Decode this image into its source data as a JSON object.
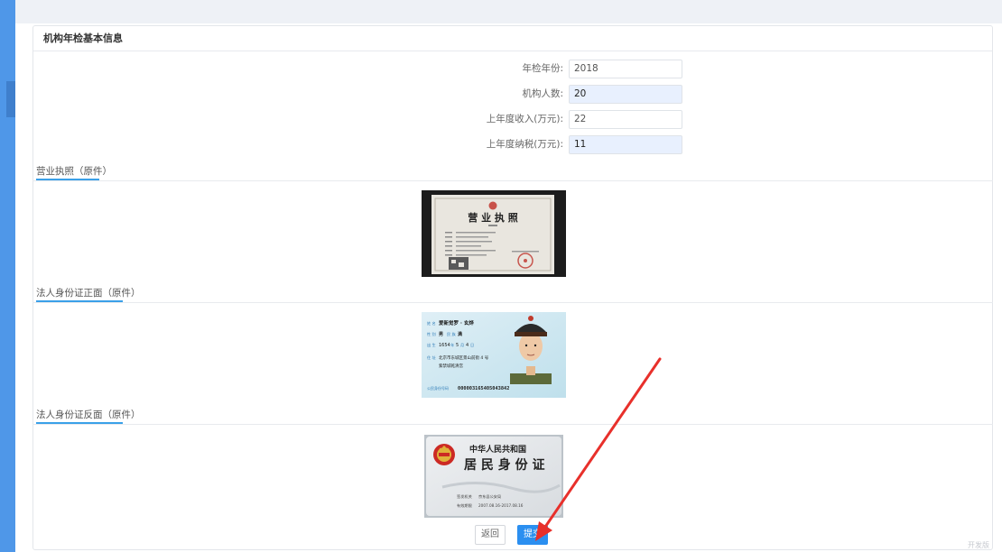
{
  "card": {
    "title": "机构年检基本信息"
  },
  "form": {
    "fields": [
      {
        "label": "年检年份:",
        "value": "2018",
        "filled": false
      },
      {
        "label": "机构人数:",
        "value": "20",
        "filled": true
      },
      {
        "label": "上年度收入(万元):",
        "value": "22",
        "filled": false
      },
      {
        "label": "上年度纳税(万元):",
        "value": "11",
        "filled": true
      }
    ]
  },
  "sections": {
    "business_license": {
      "title": "营业执照（原件）",
      "image_text": "营 业 执 照"
    },
    "id_front": {
      "title": "法人身份证正面（原件）",
      "name_label": "姓 名",
      "name": "爱新觉罗 · 玄烨",
      "gender_label": "性 别",
      "gender": "男",
      "ethnicity_label": "民 族",
      "ethnicity": "满",
      "birth_label": "出 生",
      "birth_year": "1654",
      "birth_year_unit": "年",
      "birth_month": "5",
      "birth_month_unit": "月",
      "birth_day": "4",
      "birth_day_unit": "日",
      "address_label": "住 址",
      "address_line1": "北京市东城区景山前街 4 号",
      "address_line2": "紫禁城乾清宫",
      "id_label": "公民身份号码",
      "id_number": "000003165405043842"
    },
    "id_back": {
      "title": "法人身份证反面（原件）",
      "country": "中华人民共和国",
      "card_name": "居 民 身 份 证",
      "authority_label": "签发机关",
      "authority": "京东县公安局",
      "validity_label": "有效期限",
      "validity": "2007.08.16-2017.08.16"
    }
  },
  "buttons": {
    "back": "返回",
    "submit": "提交"
  },
  "watermark": "开发版",
  "colors": {
    "accent": "#2b8ff0",
    "left_bar": "#4f97e8",
    "section_underline": "#3aa0e8",
    "annotation_arrow": "#e8302b"
  }
}
